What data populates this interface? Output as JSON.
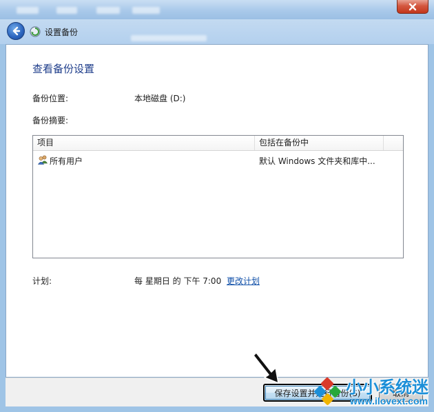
{
  "window": {
    "title": "设置备份",
    "close_icon": "close-icon"
  },
  "page": {
    "heading": "查看备份设置",
    "location_label": "备份位置:",
    "location_value": "本地磁盘 (D:)",
    "summary_label": "备份摘要:",
    "table": {
      "columns": [
        "项目",
        "包括在备份中",
        ""
      ],
      "rows": [
        {
          "icon": "users-icon",
          "item": "所有用户",
          "included": "默认 Windows 文件夹和库中..."
        }
      ]
    },
    "schedule_label": "计划:",
    "schedule_value": "每 星期日 的 下午 7:00",
    "schedule_link": "更改计划"
  },
  "footer": {
    "save_button": "保存设置并运行备份(S)",
    "cancel_button": "取消"
  },
  "watermark": {
    "name": "小小系统迷",
    "url": "www.ilovext.com"
  },
  "colors": {
    "heading": "#1d3c8a",
    "link": "#0f4fa8",
    "titlebar": "#a9c9ea",
    "close_button": "#c2361c",
    "watermark": "#1c8fd8"
  }
}
